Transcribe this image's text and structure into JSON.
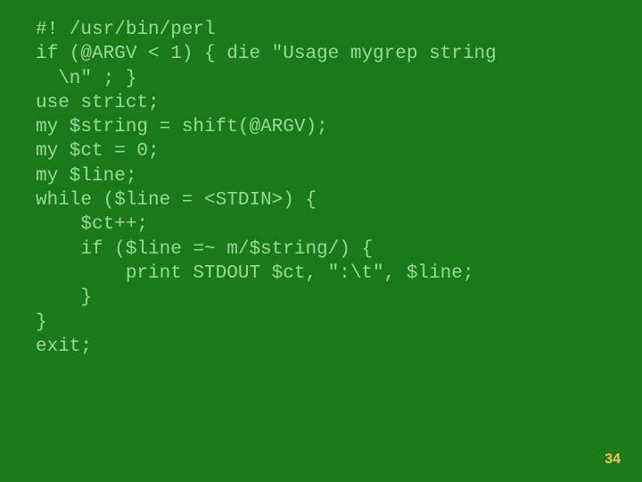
{
  "slide": {
    "page_number": "34",
    "code_lines": [
      "#! /usr/bin/perl",
      "if (@ARGV < 1) { die \"Usage mygrep string",
      "  \\n\" ; }",
      "use strict;",
      "my $string = shift(@ARGV);",
      "my $ct = 0;",
      "my $line;",
      "while ($line = <STDIN>) {",
      "    $ct++;",
      "    if ($line =~ m/$string/) {",
      "        print STDOUT $ct, \":\\t\", $line;",
      "    }",
      "}",
      "exit;"
    ]
  }
}
